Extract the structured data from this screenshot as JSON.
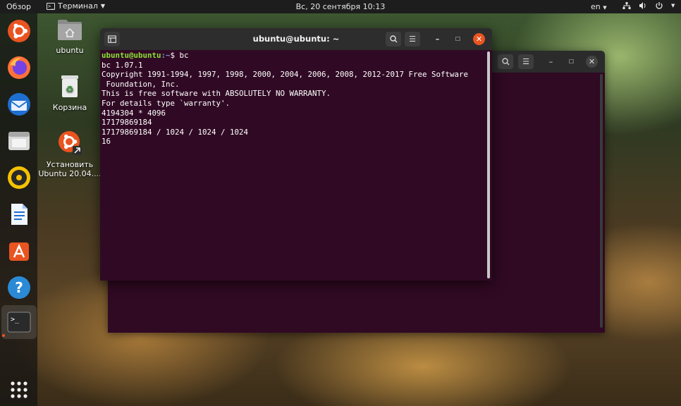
{
  "topbar": {
    "activities": "Обзор",
    "app_menu": "Терминал",
    "clock": "Вс, 20 сентября  10:13",
    "lang": "en"
  },
  "desktop": {
    "home": "ubuntu",
    "trash": "Корзина",
    "install_line1": "Установить",
    "install_line2": "Ubuntu 20.04...."
  },
  "terminal": {
    "title": "ubuntu@ubuntu: ~",
    "prompt_user": "ubuntu@ubuntu",
    "prompt_path": ":~",
    "prompt_cmd": "$ bc",
    "lines": [
      "bc 1.07.1",
      "Copyright 1991-1994, 1997, 1998, 2000, 2004, 2006, 2008, 2012-2017 Free Software",
      " Foundation, Inc.",
      "This is free software with ABSOLUTELY NO WARRANTY.",
      "For details type `warranty'.",
      "4194304 * 4096",
      "17179869184",
      "17179869184 / 1024 / 1024 / 1024",
      "16"
    ]
  },
  "colors": {
    "terminal_bg": "#300a24",
    "accent": "#e95420",
    "prompt_user": "#8ae234",
    "prompt_path": "#729fcf"
  },
  "icons": {
    "dock": [
      "ubuntu-logo-icon",
      "firefox-icon",
      "thunderbird-icon",
      "files-icon",
      "rhythmbox-icon",
      "writer-icon",
      "software-center-icon",
      "help-icon",
      "terminal-icon",
      "app-grid-icon"
    ]
  }
}
